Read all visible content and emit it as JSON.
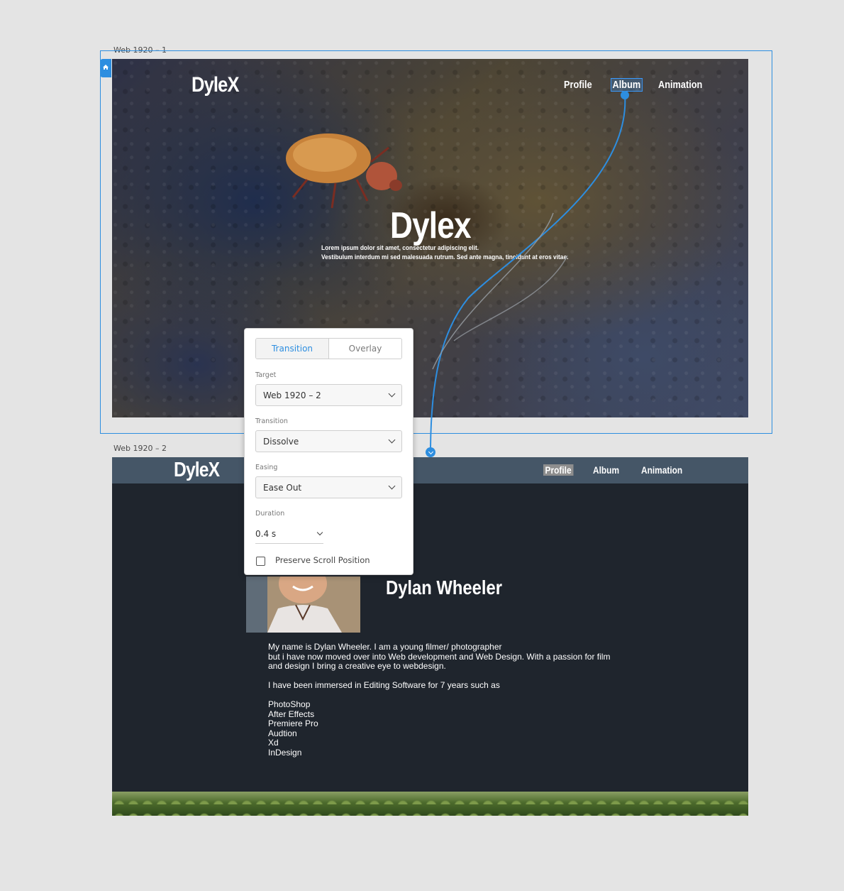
{
  "artboards": {
    "first": {
      "label": "Web 1920 – 1",
      "brand": "DyleX",
      "nav": [
        "Profile",
        "Album",
        "Animation"
      ],
      "hero_title": "Dylex",
      "hero_line1": "Lorem ipsum dolor sit amet, consectetur adipiscing elit.",
      "hero_line2": "Vestibulum interdum mi sed malesuada rutrum. Sed ante magna, tincidunt at eros vitae."
    },
    "second": {
      "label": "Web 1920 – 2",
      "brand": "DyleX",
      "nav": [
        "Profile",
        "Album",
        "Animation"
      ],
      "name": "Dylan Wheeler",
      "bio_lines": [
        "My name is Dylan Wheeler. I am a young filmer/ photographer",
        "but i have now moved over into Web development and Web Design. With a passion for film",
        "and design I bring a creative eye to webdesign.",
        "",
        "I have been immersed in Editing Software for 7 years such as",
        "",
        "PhotoShop",
        "After Effects",
        "Premiere Pro",
        "Audtion",
        "Xd",
        "InDesign"
      ]
    }
  },
  "interaction_panel": {
    "tabs": [
      "Transition",
      "Overlay"
    ],
    "active_tab": "Transition",
    "target_label": "Target",
    "target_value": "Web 1920 – 2",
    "transition_label": "Transition",
    "transition_value": "Dissolve",
    "easing_label": "Easing",
    "easing_value": "Ease Out",
    "duration_label": "Duration",
    "duration_value": "0.4 s",
    "preserve_scroll_label": "Preserve Scroll Position",
    "preserve_scroll_checked": false
  },
  "colors": {
    "accent": "#2d8ee0",
    "canvas": "#e4e4e4",
    "artboard2_bg": "#1f252d",
    "artboard2_header": "#455667"
  },
  "icons": [
    "home-icon",
    "chevron-down-icon",
    "wire-connector-icon"
  ]
}
